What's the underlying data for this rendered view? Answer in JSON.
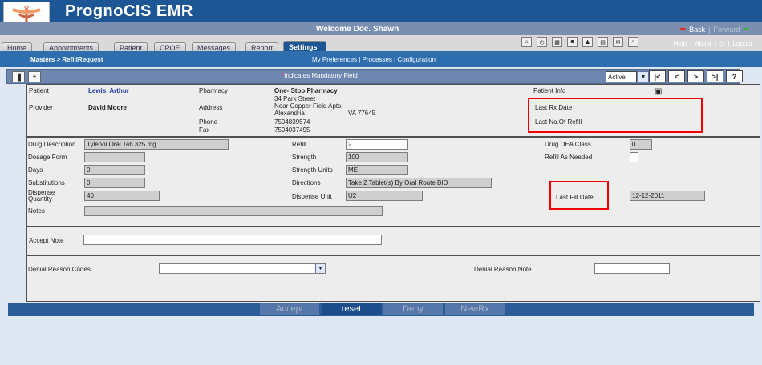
{
  "app": {
    "title": "PrognoCIS EMR",
    "welcome": "Welcome Doc. Shawn"
  },
  "header": {
    "back": "Back",
    "forward": "Forward"
  },
  "tabs": [
    "Home",
    "Appointments",
    "Patient",
    "CPOE",
    "Messages",
    "Report",
    "Settings"
  ],
  "top_links": [
    "Help",
    "About",
    "Logout"
  ],
  "breadcrumb": "Masters > RefillRequest",
  "submenu": "My Preferences | Processes | Configuration",
  "toolbar": {
    "mandatory_star": "*",
    "mandatory_text": "Indicates Mandatory Field",
    "status_value": "Active",
    "nav": [
      "|<",
      "<",
      ">",
      ">|",
      "?"
    ]
  },
  "patient_panel": {
    "patient_label": "Patient",
    "patient_value": "Lewis, Arthur",
    "provider_label": "Provider",
    "provider_value": "David Moore",
    "pharmacy_label": "Pharmacy",
    "pharmacy_value": "One- Stop Pharmacy",
    "address_label": "Address",
    "address_lines": [
      "34 Park Street",
      "Near Copper Field Apts.",
      "Alexandria"
    ],
    "address_state_zip": "VA 77645",
    "phone_label": "Phone",
    "phone_value": "7594839574",
    "fax_label": "Fax",
    "fax_value": "7504037495",
    "patient_info_label": "Patient Info",
    "last_rx_label": "Last Rx Date",
    "last_refill_label": "Last No.Of Refill"
  },
  "drug_panel": {
    "drug_description_label": "Drug Description",
    "drug_description_value": "Tylenol Oral Tab 325 mg",
    "dosage_form_label": "Dosage Form",
    "dosage_form_value": "",
    "days_label": "Days",
    "days_value": "0",
    "substitutions_label": "Substitutions",
    "substitutions_value": "0",
    "dispense_quantity_label_1": "Dispense",
    "dispense_quantity_label_2": "Quantity",
    "dispense_quantity_value": "40",
    "notes_label": "Notes",
    "notes_value": "",
    "refill_label": "Refill",
    "refill_value": "2",
    "strength_label": "Strength",
    "strength_value": "100",
    "strength_units_label": "Strength Units",
    "strength_units_value": "ME",
    "directions_label": "Directions",
    "directions_value": "Take 2 Tablet(s) By Oral Route  BID",
    "dispense_unit_label": "Dispense Unit",
    "dispense_unit_value": "U2",
    "drug_dea_class_label": "Drug DEA Class",
    "drug_dea_class_value": "0",
    "refill_as_needed_label": "Refill As Needed",
    "last_fill_date_label": "Last Fill Date",
    "last_fill_date_value": "12-12-2011"
  },
  "accept_panel": {
    "accept_note_label": "Accept Note",
    "accept_note_value": ""
  },
  "denial_panel": {
    "denial_reason_codes_label": "Denial Reason Codes",
    "denial_reason_note_label": "Denial Reason Note"
  },
  "actions": {
    "accept": "Accept",
    "reset": "reset",
    "deny": "Deny",
    "newrx": "NewRx"
  }
}
